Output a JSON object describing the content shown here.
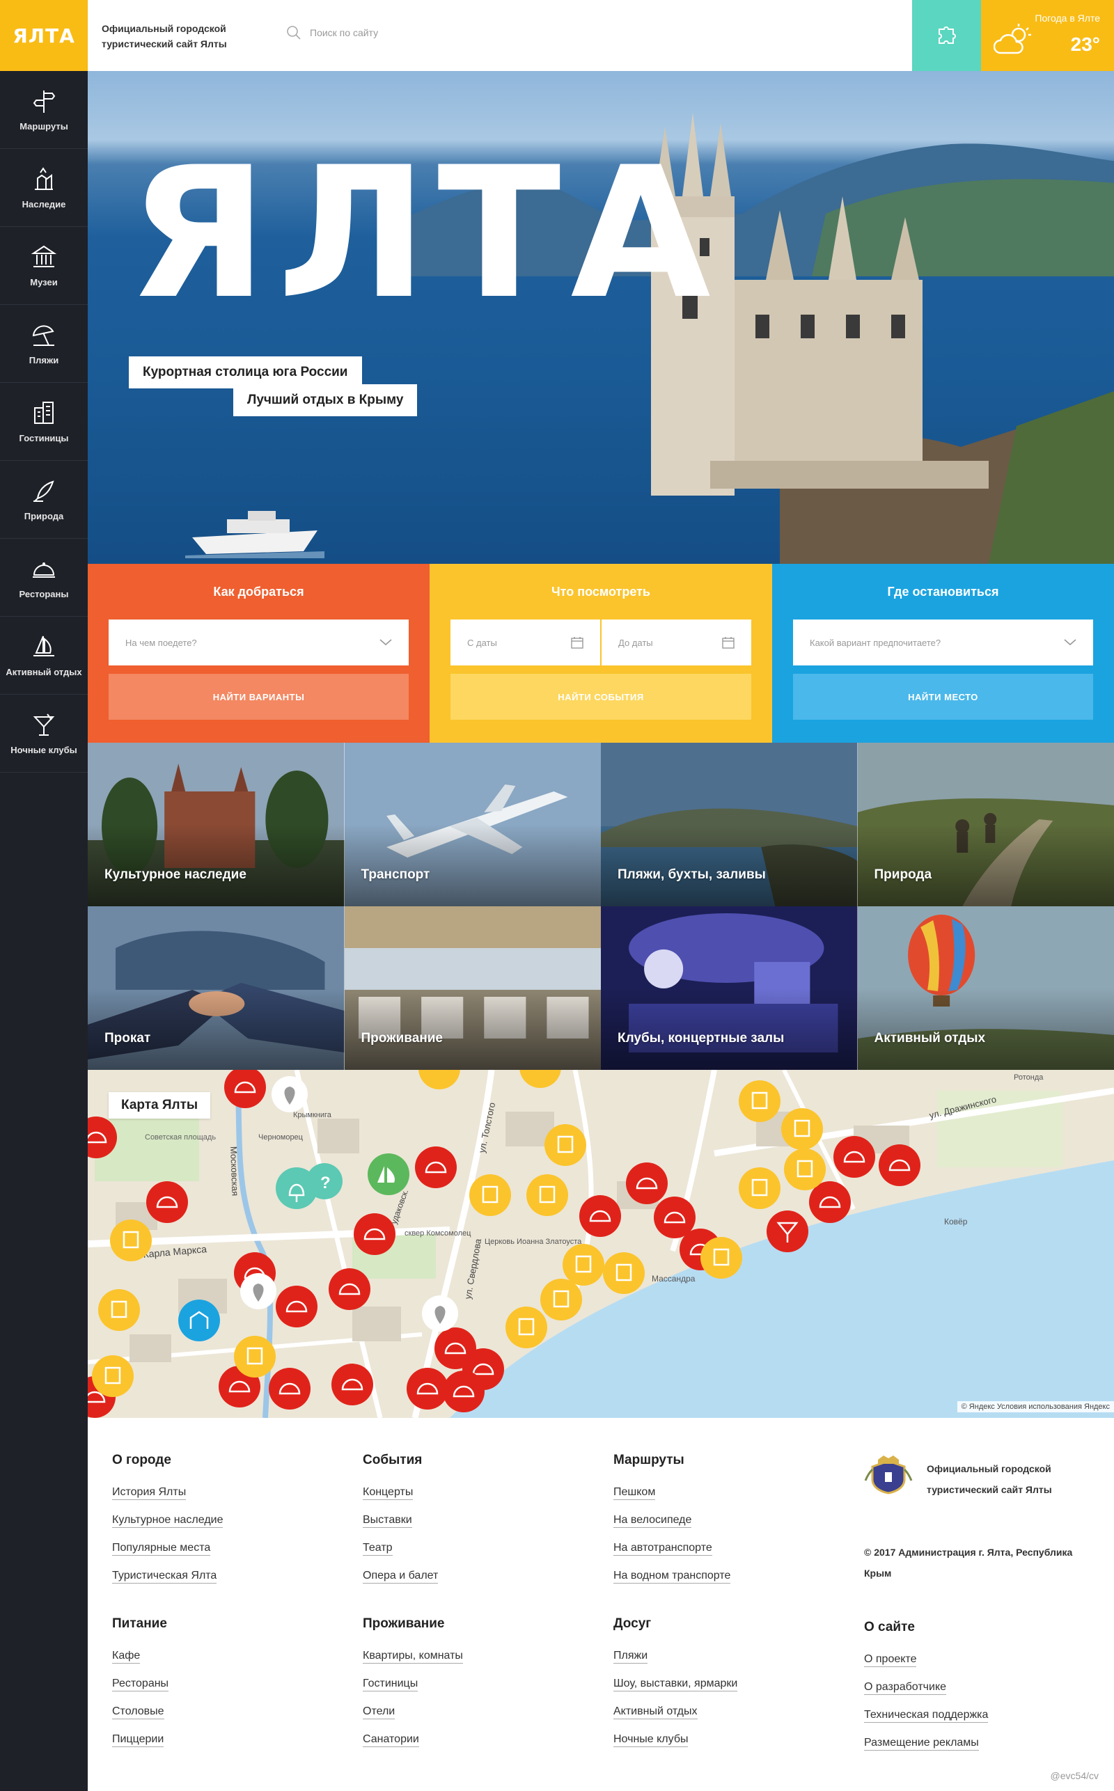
{
  "header": {
    "logo": "ЯЛТА",
    "site_title": "Официальный городской туристический сайт Ялты",
    "search_placeholder": "Поиск по сайту",
    "weather_label": "Погода в Ялте",
    "weather_temp": "23°"
  },
  "sidebar": {
    "items": [
      {
        "label": "Маршруты",
        "icon": "signpost-icon"
      },
      {
        "label": "Наследие",
        "icon": "monument-icon"
      },
      {
        "label": "Музеи",
        "icon": "museum-icon"
      },
      {
        "label": "Пляжи",
        "icon": "beach-umbrella-icon"
      },
      {
        "label": "Гостиницы",
        "icon": "hotel-icon"
      },
      {
        "label": "Природа",
        "icon": "nature-icon"
      },
      {
        "label": "Рестораны",
        "icon": "cloche-icon"
      },
      {
        "label": "Активный отдых",
        "icon": "sailboat-icon"
      },
      {
        "label": "Ночные клубы",
        "icon": "cocktail-icon"
      }
    ]
  },
  "hero": {
    "title": "ЯЛТА",
    "tag1": "Курортная столица юга России",
    "tag2": "Лучший отдых в Крыму"
  },
  "booking": {
    "transport": {
      "title": "Как добраться",
      "placeholder": "На чем поедете?",
      "button": "НАЙТИ ВАРИАНТЫ"
    },
    "events": {
      "title": "Что посмотреть",
      "from": "С даты",
      "to": "До даты",
      "button": "НАЙТИ СОБЫТИЯ"
    },
    "stay": {
      "title": "Где остановиться",
      "placeholder": "Какой вариант предпочитаете?",
      "button": "НАЙТИ МЕСТО"
    }
  },
  "categories": [
    "Культурное наследие",
    "Транспорт",
    "Пляжи, бухты, заливы",
    "Природа",
    "Прокат",
    "Проживание",
    "Клубы, концертные залы",
    "Активный отдых"
  ],
  "map": {
    "label": "Карта Ялты",
    "copyright": "© Яндекс Условия использования  Яндекс",
    "streets": [
      "ул. Толстого",
      "ул. Дражинского",
      "Московская",
      "Карла Маркса",
      "ул. Свердлова",
      "Рудаковск.",
      "Советская площадь",
      "Массандра",
      "Ковёр",
      "Ротонда",
      "Черноморец",
      "Крымкнига",
      "сквер Комсомолец",
      "Церковь Иоанна Златоуста"
    ]
  },
  "footer": {
    "columns": [
      {
        "title": "О городе",
        "links": [
          "История Ялты",
          "Культурное наследие",
          "Популярные места",
          "Туристическая Ялта"
        ]
      },
      {
        "title": "События",
        "links": [
          "Концерты",
          "Выставки",
          "Театр",
          "Опера и балет"
        ]
      },
      {
        "title": "Маршруты",
        "links": [
          "Пешком",
          "На велосипеде",
          "На автотранспорте",
          "На водном транспорте"
        ]
      },
      {
        "title": "Питание",
        "links": [
          "Кафе",
          "Рестораны",
          "Столовые",
          "Пиццерии"
        ]
      },
      {
        "title": "Проживание",
        "links": [
          "Квартиры, комнаты",
          "Гостиницы",
          "Отели",
          "Санатории"
        ]
      },
      {
        "title": "Досуг",
        "links": [
          "Пляжи",
          "Шоу, выставки, ярмарки",
          "Активный отдых",
          "Ночные клубы"
        ]
      },
      {
        "title": "О сайте",
        "links": [
          "О проекте",
          "О разработчике",
          "Техническая поддержка",
          "Размещение рекламы"
        ]
      }
    ],
    "site_title": "Официальный городской туристический сайт Ялты",
    "copyright": "© 2017 Администрация г. Ялта, Республика Крым",
    "watermark": "@evc54/cv"
  },
  "colors": {
    "yellow": "#f9bc15",
    "orange": "#ef5f2f",
    "blue": "#1ba3e0",
    "teal": "#5bd6c0",
    "sidebar": "#1e2128",
    "map_red": "#e0231a",
    "map_yellow": "#fbc42c"
  }
}
